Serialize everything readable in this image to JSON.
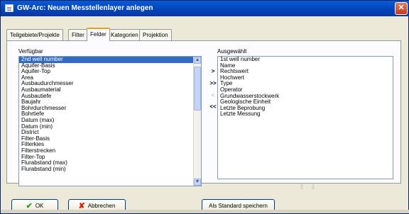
{
  "window": {
    "title": "GW-Arc: Neuen Messtellenlayer anlegen",
    "close_label": "✕"
  },
  "tabs": [
    {
      "label": "Teilgebiete/Projekte"
    },
    {
      "label": "Filter"
    },
    {
      "label": "Felder"
    },
    {
      "label": "Kategorien"
    },
    {
      "label": "Projektion"
    }
  ],
  "left": {
    "label": "Verfügbar",
    "items": [
      "2nd well number",
      "Aquifer-Basis",
      "Aquifer-Top",
      "Area",
      "Ausbaudurchmesser",
      "Ausbaumaterial",
      "Ausbautiefe",
      "Baujahr",
      "Bohrdurchmesser",
      "Bohrtiefe",
      "Datum (max)",
      "Datum (min)",
      "District",
      "Filter-Basis",
      "Filterkies",
      "Filterstrecken",
      "Filter-Top",
      "Flurabstand (max)",
      "Flurabstand (min)"
    ],
    "selected_index": 0
  },
  "mid_buttons": [
    ">",
    ">>",
    "<",
    "<<"
  ],
  "right": {
    "label": "Ausgewählt",
    "items": [
      "1st well number",
      "Name",
      "Rechtswert",
      "Hochwert",
      "Type",
      "Operator",
      "Grundwasserstockwerk",
      "Geologische Einheit",
      "Letzte Beprobung",
      "Letzte Messung"
    ]
  },
  "order_arrows": {
    "up": "⇧",
    "down": "⇩"
  },
  "scroll": {
    "up": "▲",
    "down": "▼"
  },
  "buttons": {
    "ok_icon": "✔",
    "ok": "OK",
    "cancel_icon": "✘",
    "cancel": "Abbrechen",
    "save_default": "Als Standard speichern"
  }
}
